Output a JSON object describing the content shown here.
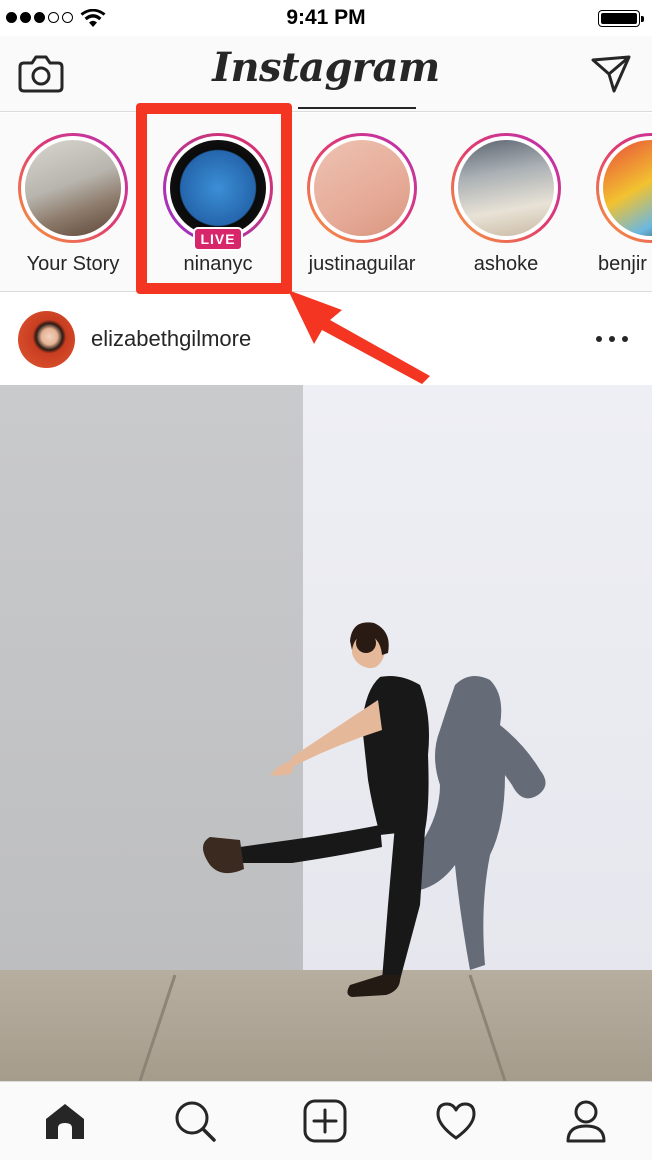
{
  "status_bar": {
    "time": "9:41 PM",
    "signal_bars": 3,
    "signal_total": 5
  },
  "header": {
    "logo": "Instagram",
    "left_icon": "camera-icon",
    "right_icon": "direct-message-icon"
  },
  "stories": [
    {
      "label": "Your Story",
      "live": false
    },
    {
      "label": "ninanyc",
      "live": true,
      "badge": "LIVE"
    },
    {
      "label": "justinaguilar",
      "live": false
    },
    {
      "label": "ashoke",
      "live": false
    },
    {
      "label": "benjir",
      "live": false
    }
  ],
  "post": {
    "username": "elizabethgilmore",
    "more_icon": "more-options-icon"
  },
  "tabbar": [
    {
      "icon": "home-icon",
      "active": true
    },
    {
      "icon": "search-icon",
      "active": false
    },
    {
      "icon": "add-post-icon",
      "active": false
    },
    {
      "icon": "activity-heart-icon",
      "active": false
    },
    {
      "icon": "profile-icon",
      "active": false
    }
  ],
  "colors": {
    "highlight": "#f33522",
    "live_badge": "#d8266a",
    "text": "#262626",
    "border": "#dbdbdb"
  }
}
